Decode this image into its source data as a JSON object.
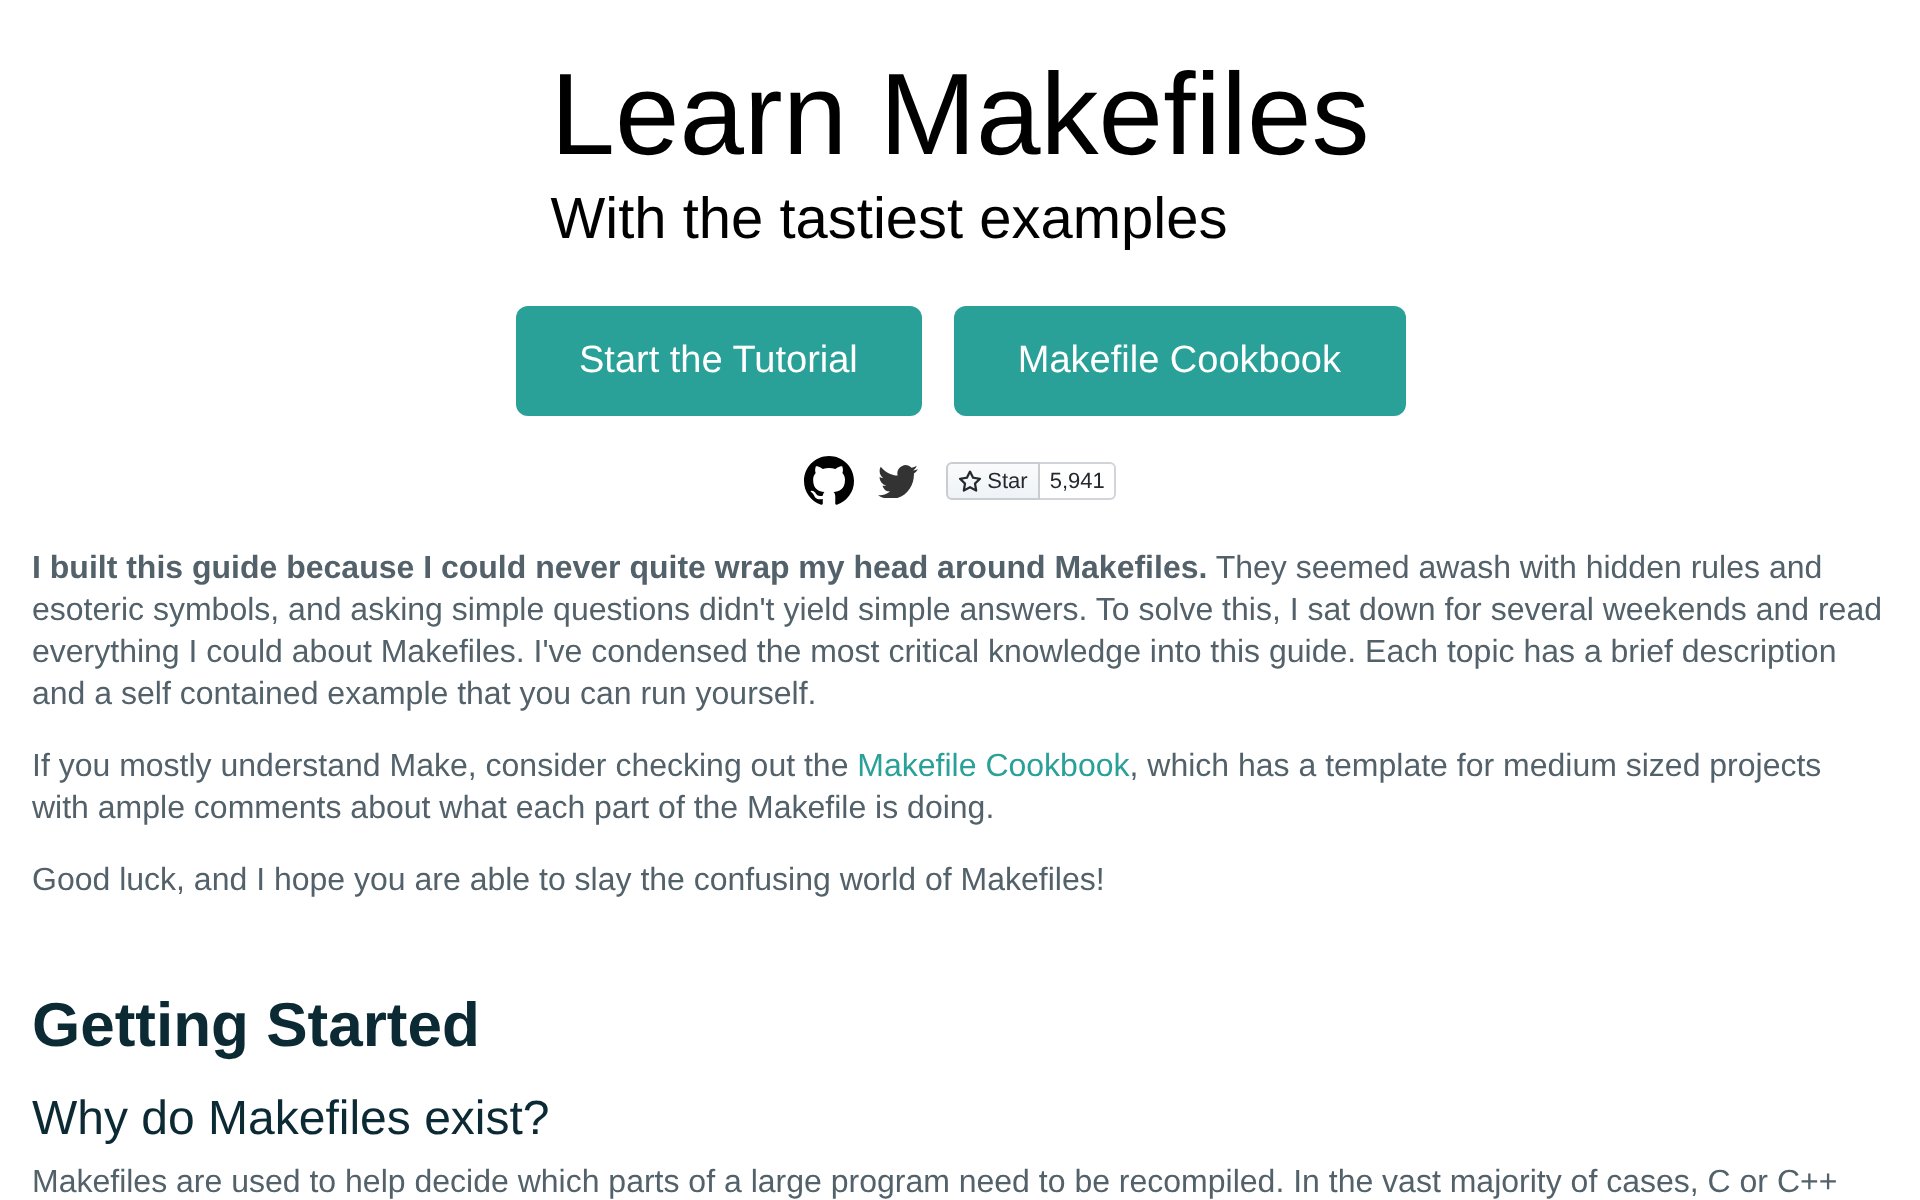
{
  "header": {
    "title": "Learn Makefiles",
    "subtitle": "With the tastiest examples"
  },
  "buttons": [
    {
      "label": "Start the Tutorial"
    },
    {
      "label": "Makefile Cookbook"
    }
  ],
  "social": {
    "star": {
      "label": "Star",
      "count": "5,941"
    }
  },
  "intro": [
    {
      "parts": [
        {
          "kind": "text",
          "text": "**I built this guide because I could never quite wrap my head around Makefiles.** They seemed awash with hidden rules and esoteric symbols, and asking simple questions didn't yield simple answers. To solve this, I sat down for several weekends and read everything I could about Makefiles. I've condensed the most critical knowledge into this guide. Each topic has a brief description and a self contained example that you can run yourself."
        }
      ]
    },
    {
      "parts": [
        {
          "kind": "text",
          "text": "If you mostly understand Make, consider checking out the "
        },
        {
          "kind": "link",
          "text": "Makefile Cookbook"
        },
        {
          "kind": "text",
          "text": ", which has a template for medium sized projects with ample comments about what each part of the Makefile is doing."
        }
      ]
    },
    {
      "parts": [
        {
          "kind": "text",
          "text": "Good luck, and I hope you are able to slay the confusing world of Makefiles!"
        }
      ]
    }
  ],
  "sections": [
    {
      "heading": "Getting Started",
      "subsections": [
        {
          "heading": "Why do Makefiles exist?",
          "paragraphs": [
            "Makefiles are used to help decide which parts of a large program need to be recompiled. In the vast majority of cases, C or C++"
          ]
        }
      ]
    }
  ]
}
